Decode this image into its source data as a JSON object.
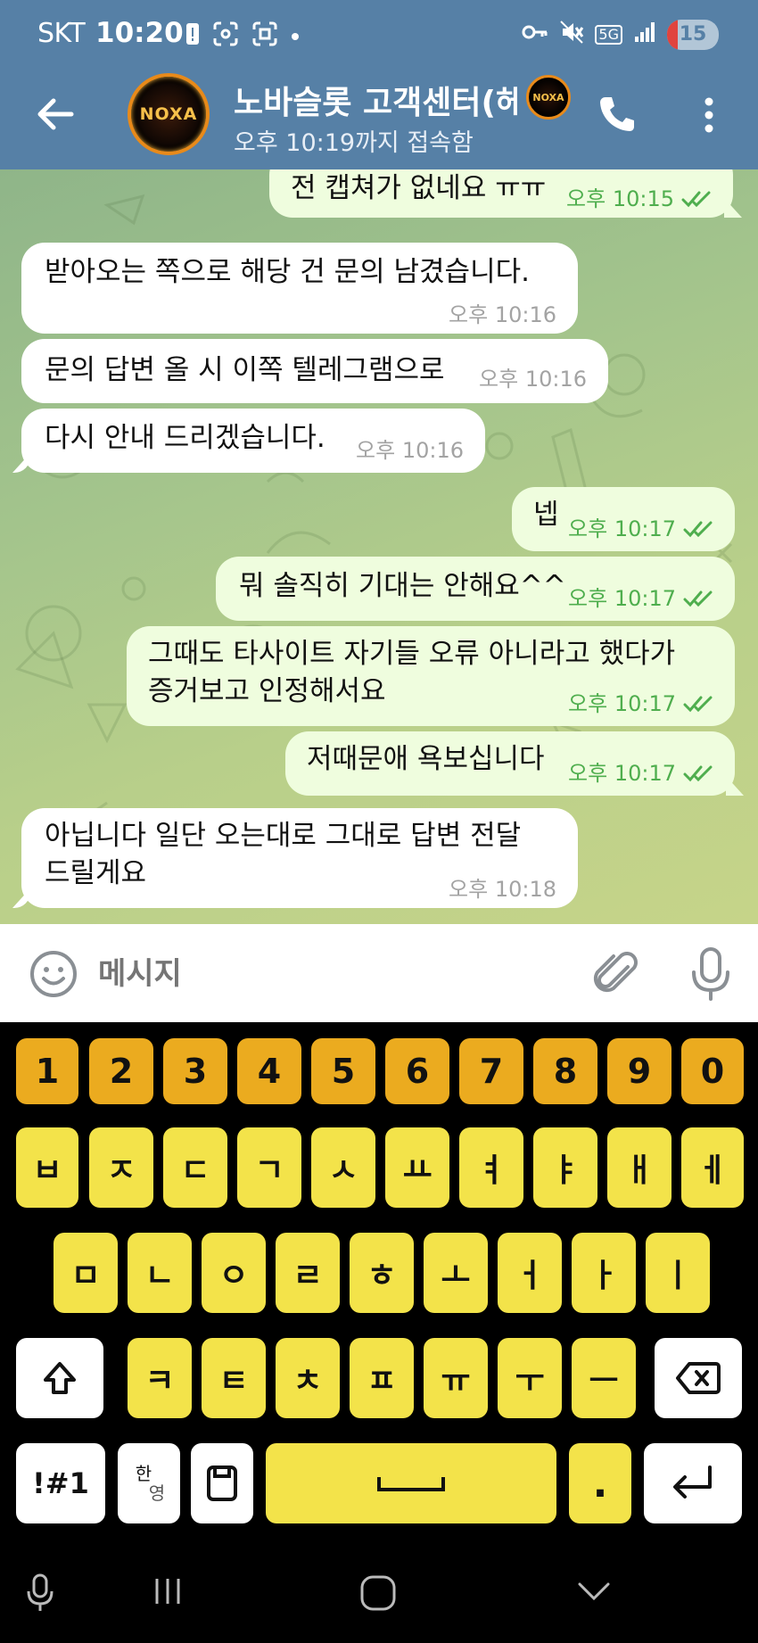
{
  "status_bar": {
    "carrier": "SKT",
    "time": "10:20",
    "network": "5G",
    "battery": "15"
  },
  "header": {
    "title": "노바슬롯 고객센터(헤",
    "subtitle": "오후 10:19까지 접속함",
    "avatar_logo": "NOXA"
  },
  "messages": [
    {
      "dir": "out",
      "text": "전 캡쳐가 없네요 ㅠㅠ",
      "time": "오후 10:15",
      "read": true
    },
    {
      "dir": "in",
      "text": "받아오는 쪽으로 해당 건 문의 남겼습니다.",
      "time": "오후 10:16"
    },
    {
      "dir": "in",
      "text": "문의 답변 올 시 이쪽 텔레그램으로",
      "time": "오후 10:16"
    },
    {
      "dir": "in",
      "text": "다시 안내 드리겠습니다.",
      "time": "오후 10:16"
    },
    {
      "dir": "out",
      "text": "넵",
      "time": "오후 10:17",
      "read": true
    },
    {
      "dir": "out",
      "text": "뭐 솔직히 기대는 안해요^^",
      "time": "오후 10:17",
      "read": true
    },
    {
      "dir": "out",
      "text": "그때도 타사이트 자기들 오류 아니라고 했다가",
      "text2": "증거보고 인정해서요",
      "time": "오후 10:17",
      "read": true
    },
    {
      "dir": "out",
      "text": "저때문애 욕보십니다",
      "time": "오후 10:17",
      "read": true
    },
    {
      "dir": "in",
      "text": "아닙니다 일단 오는대로 그대로 답변 전달",
      "text2": "드릴게요",
      "time": "오후 10:18"
    }
  ],
  "composer": {
    "placeholder": "메시지"
  },
  "keyboard": {
    "row_numbers": [
      "1",
      "2",
      "3",
      "4",
      "5",
      "6",
      "7",
      "8",
      "9",
      "0"
    ],
    "row1": [
      "ㅂ",
      "ㅈ",
      "ㄷ",
      "ㄱ",
      "ㅅ",
      "ㅛ",
      "ㅕ",
      "ㅑ",
      "ㅐ",
      "ㅔ"
    ],
    "row2": [
      "ㅁ",
      "ㄴ",
      "ㅇ",
      "ㄹ",
      "ㅎ",
      "ㅗ",
      "ㅓ",
      "ㅏ",
      "ㅣ"
    ],
    "row3": [
      "ㅋ",
      "ㅌ",
      "ㅊ",
      "ㅍ",
      "ㅠ",
      "ㅜ",
      "ㅡ"
    ],
    "symbols_label": "!#1",
    "lang_top": "한",
    "lang_bottom": "영",
    "period": "."
  },
  "colors": {
    "header_bg": "#5680a6",
    "bubble_in": "#ffffff",
    "bubble_out": "#effdde",
    "check_green": "#4fae4e",
    "key_number": "#ebab1f",
    "key_letter": "#f3e34a"
  }
}
